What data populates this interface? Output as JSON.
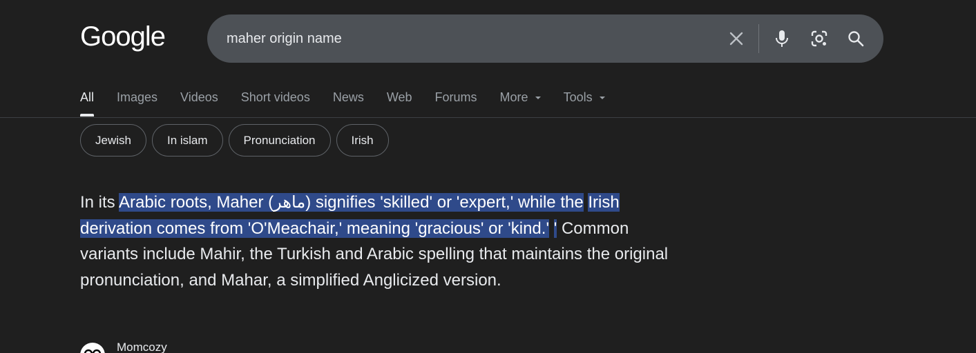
{
  "logo": {
    "text": "Google"
  },
  "search": {
    "query": "maher origin name",
    "icons": [
      "close-icon",
      "microphone-icon",
      "lens-icon",
      "search-icon"
    ]
  },
  "tabs": [
    {
      "label": "All",
      "active": true
    },
    {
      "label": "Images"
    },
    {
      "label": "Videos"
    },
    {
      "label": "Short videos"
    },
    {
      "label": "News"
    },
    {
      "label": "Web"
    },
    {
      "label": "Forums"
    },
    {
      "label": "More",
      "dropdown": true
    },
    {
      "label": "Tools",
      "dropdown": true
    }
  ],
  "chips": [
    "Jewish",
    "In islam",
    "Pronunciation",
    "Irish"
  ],
  "answer": {
    "prefix": "In its ",
    "highlighted_1": "Arabic roots, Maher (ماهر) signifies 'skilled' or 'expert,' while the",
    "highlighted_2": "Irish derivation comes from 'O'Meachair,' meaning 'gracious' or 'kind.'",
    "highlighted_3": "'",
    "rest": " Common variants include Mahir, the Turkish and Arabic spelling that maintains the original pronunciation, and Mahar, a simplified Anglicized version."
  },
  "source": {
    "name": "Momcozy"
  },
  "colors": {
    "background": "#1f1f1f",
    "searchbar": "#4d5156",
    "highlight": "#2f4a8a"
  }
}
